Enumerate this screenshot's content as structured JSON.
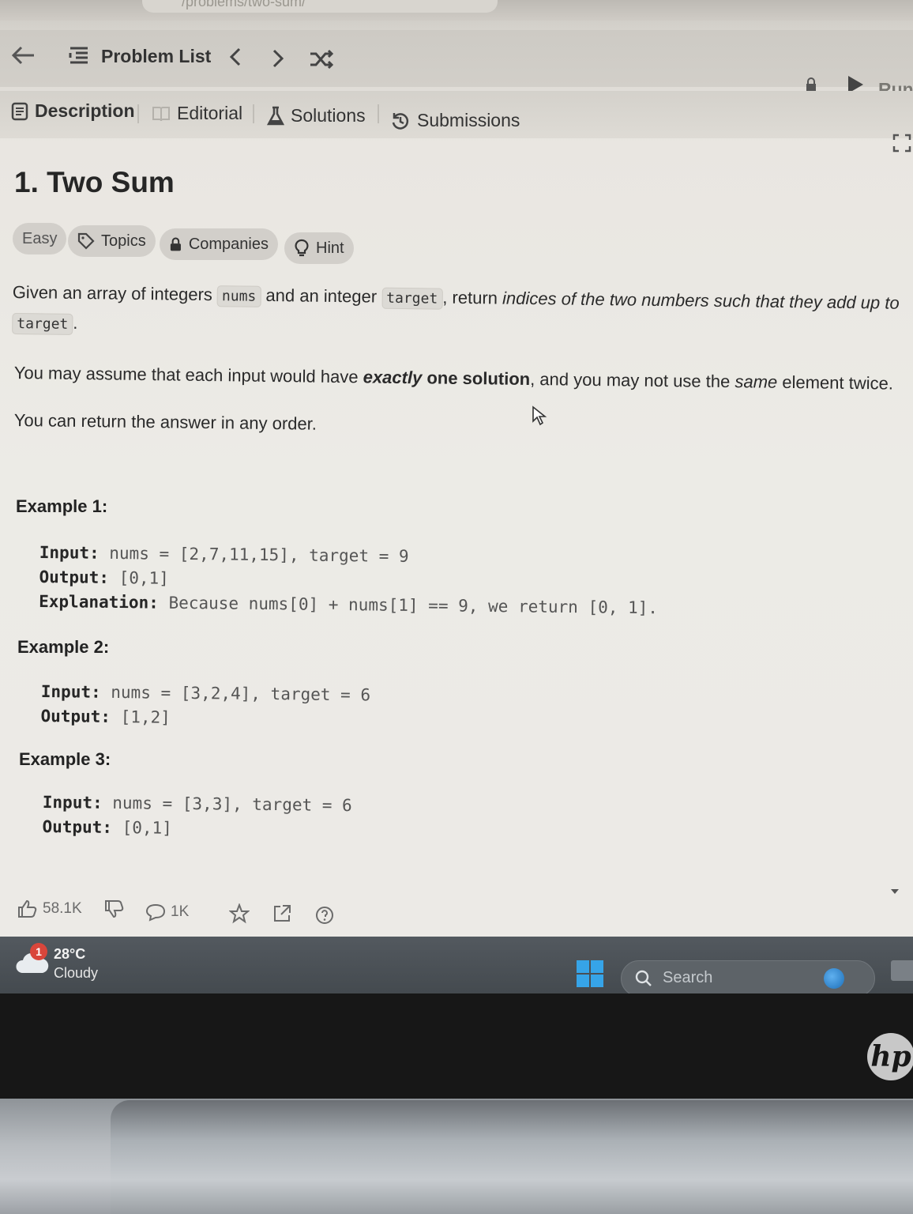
{
  "browser": {
    "url_fragment": "/problems/two-sum/"
  },
  "nav": {
    "problem_list": "Problem List",
    "run_label": "Run"
  },
  "tabs": [
    {
      "label": "Description",
      "active": true
    },
    {
      "label": "Editorial",
      "active": false
    },
    {
      "label": "Solutions",
      "active": false
    },
    {
      "label": "Submissions",
      "active": false
    }
  ],
  "problem": {
    "title": "1. Two Sum",
    "difficulty": "Easy",
    "tags": [
      "Topics",
      "Companies",
      "Hint"
    ],
    "para1_a": "Given an array of integers ",
    "para1_code1": "nums",
    "para1_b": " and an integer ",
    "para1_code2": "target",
    "para1_c": ", return ",
    "para1_em": "indices of the two numbers such that they add up to",
    "para1_code3": "target",
    "para1_d": ".",
    "para2_a": "You may assume that each input would have ",
    "para2_em": "exactly",
    "para2_strong": " one solution",
    "para2_b": ", and you may not use the ",
    "para2_em2": "same",
    "para2_c": " element twice.",
    "para3": "You can return the answer in any order."
  },
  "examples": [
    {
      "label": "Example 1:",
      "input_key": "Input:",
      "input_val": " nums = [2,7,11,15], target = 9",
      "output_key": "Output:",
      "output_val": " [0,1]",
      "expl_key": "Explanation:",
      "expl_val": " Because nums[0] + nums[1] == 9, we return [0, 1]."
    },
    {
      "label": "Example 2:",
      "input_key": "Input:",
      "input_val": " nums = [3,2,4], target = 6",
      "output_key": "Output:",
      "output_val": " [1,2]"
    },
    {
      "label": "Example 3:",
      "input_key": "Input:",
      "input_val": " nums = [3,3], target = 6",
      "output_key": "Output:",
      "output_val": " [0,1]"
    }
  ],
  "stats": {
    "likes": "58.1K",
    "comments": "1K"
  },
  "taskbar": {
    "weather_temp": "28°C",
    "weather_desc": "Cloudy",
    "weather_badge": "1",
    "search_placeholder": "Search"
  },
  "brand": "hp"
}
